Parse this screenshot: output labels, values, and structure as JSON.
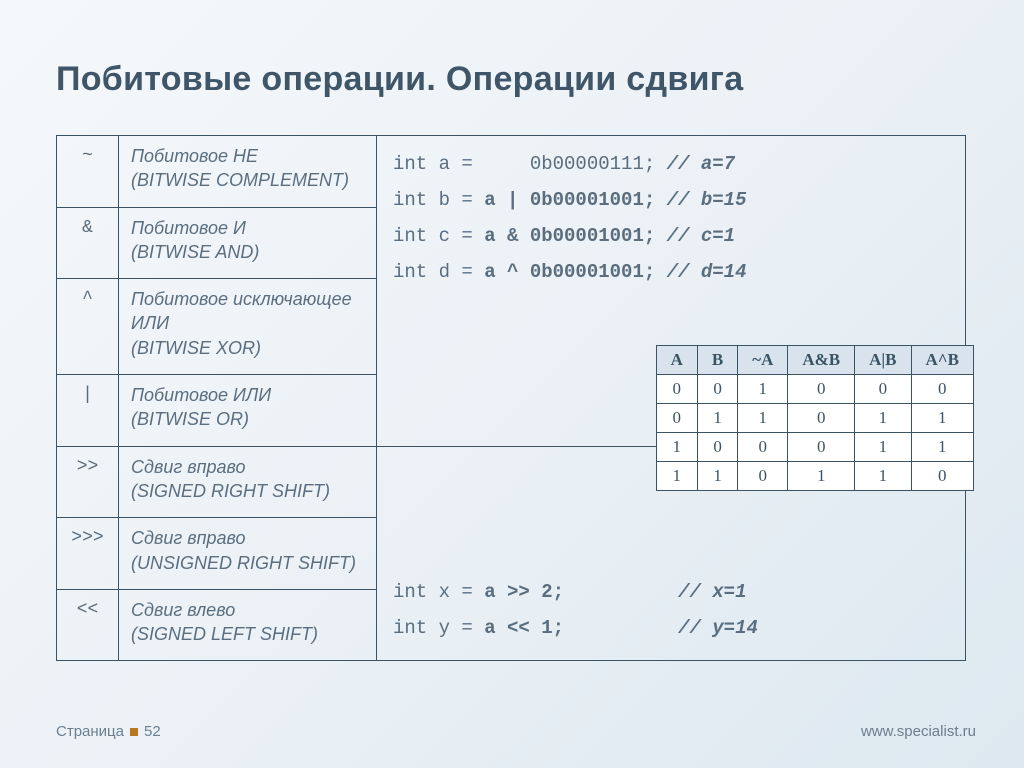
{
  "title": "Побитовые операции. Операции сдвига",
  "operators": [
    {
      "sym": "~",
      "name": "Побитовое НЕ",
      "en": "(BITWISE COMPLEMENT)"
    },
    {
      "sym": "&",
      "name": "Побитовое И",
      "en": "(BITWISE AND)"
    },
    {
      "sym": "^",
      "name": "Побитовое исключающее ИЛИ",
      "en": "(BITWISE XOR)"
    },
    {
      "sym": "|",
      "name": "Побитовое ИЛИ",
      "en": "(BITWISE OR)"
    },
    {
      "sym": ">>",
      "name": "Сдвиг вправо",
      "en": "(SIGNED RIGHT SHIFT)"
    },
    {
      "sym": ">>>",
      "name": "Сдвиг вправо",
      "en": "(UNSIGNED RIGHT SHIFT)"
    },
    {
      "sym": "<<",
      "name": "Сдвиг влево",
      "en": "(SIGNED LEFT SHIFT)"
    }
  ],
  "code_top": {
    "l1_pre": "int a =     ",
    "l1_val": "0b00000111;",
    "l1_cmt": " // a=7",
    "l2_pre": "int b = ",
    "l2_op": "a | 0b00001001;",
    "l2_cmt": " // b=15",
    "l3_pre": "int c = ",
    "l3_op": "a & 0b00001001;",
    "l3_cmt": " // c=1",
    "l4_pre": "int d = ",
    "l4_op": "a ^ 0b00001001;",
    "l4_cmt": " // d=14"
  },
  "code_bot": {
    "l1_pre": "int x = ",
    "l1_op": "a >> 2;",
    "l1_pad": "          ",
    "l1_cmt": "// x=1",
    "l2_pre": "int y = ",
    "l2_op": "a << 1;",
    "l2_pad": "          ",
    "l2_cmt": "// y=14"
  },
  "truth": {
    "headers": [
      "A",
      "B",
      "~A",
      "A&B",
      "A|B",
      "A^B"
    ],
    "rows": [
      [
        "0",
        "0",
        "1",
        "0",
        "0",
        "0"
      ],
      [
        "0",
        "1",
        "1",
        "0",
        "1",
        "1"
      ],
      [
        "1",
        "0",
        "0",
        "0",
        "1",
        "1"
      ],
      [
        "1",
        "1",
        "0",
        "1",
        "1",
        "0"
      ]
    ]
  },
  "footer": {
    "page_label": "Страница",
    "page_num": "52",
    "url": "www.specialist.ru"
  }
}
